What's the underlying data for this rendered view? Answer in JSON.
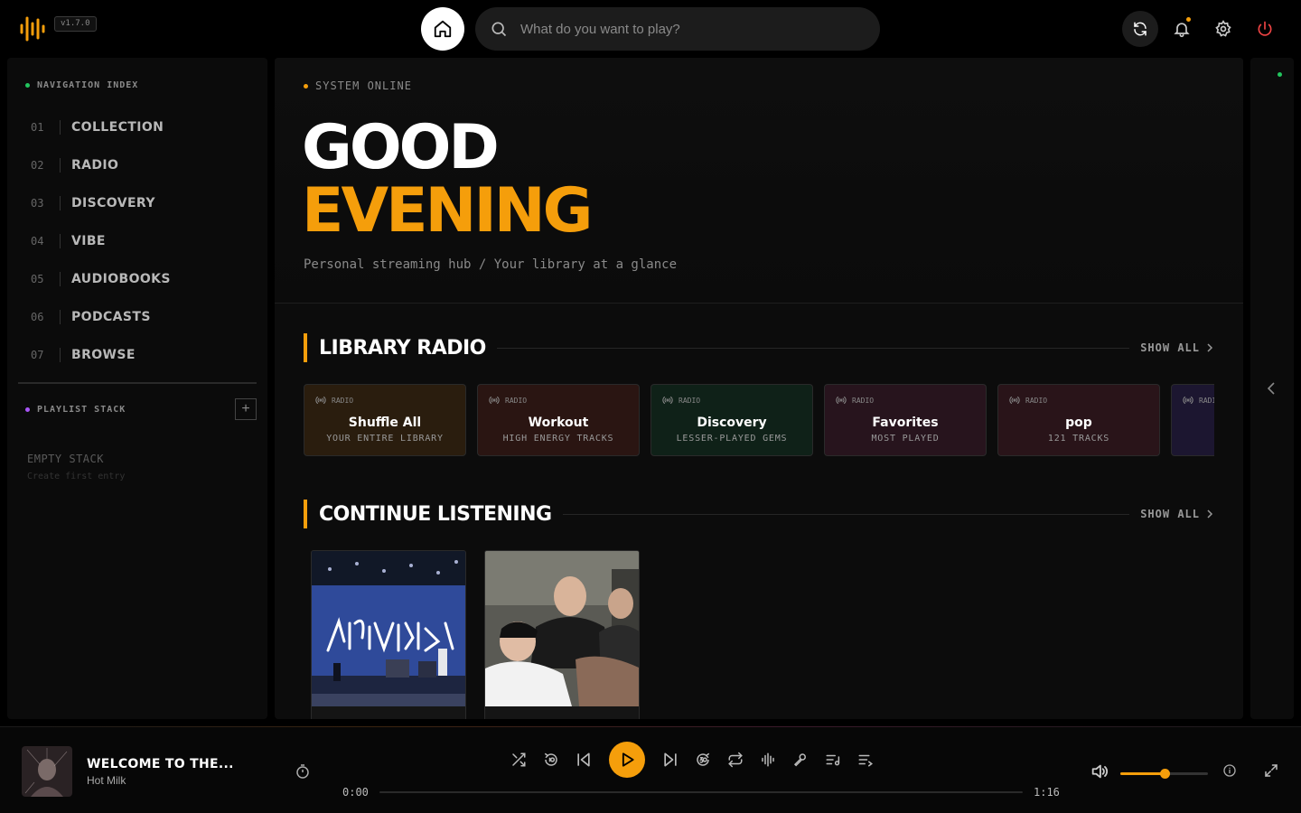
{
  "app": {
    "version": "v1.7.0"
  },
  "search": {
    "placeholder": "What do you want to play?"
  },
  "sidebar": {
    "nav_label": "NAVIGATION INDEX",
    "items": [
      {
        "num": "01",
        "label": "COLLECTION"
      },
      {
        "num": "02",
        "label": "RADIO"
      },
      {
        "num": "03",
        "label": "DISCOVERY"
      },
      {
        "num": "04",
        "label": "VIBE"
      },
      {
        "num": "05",
        "label": "AUDIOBOOKS"
      },
      {
        "num": "06",
        "label": "PODCASTS"
      },
      {
        "num": "07",
        "label": "BROWSE"
      }
    ],
    "playlist_label": "PLAYLIST STACK",
    "add_symbol": "+",
    "empty_title": "EMPTY STACK",
    "empty_sub": "Create first entry"
  },
  "hero": {
    "status": "SYSTEM ONLINE",
    "line1": "GOOD",
    "line2": "EVENING",
    "subtitle": "Personal streaming hub / Your library at a glance"
  },
  "library_radio": {
    "title": "LIBRARY RADIO",
    "show_all": "SHOW ALL",
    "cards": [
      {
        "tag": "RADIO",
        "title": "Shuffle All",
        "sub": "YOUR ENTIRE LIBRARY",
        "bg": "#2a1d0e"
      },
      {
        "tag": "RADIO",
        "title": "Workout",
        "sub": "HIGH ENERGY TRACKS",
        "bg": "#2a1512"
      },
      {
        "tag": "RADIO",
        "title": "Discovery",
        "sub": "LESSER-PLAYED GEMS",
        "bg": "#0f2118"
      },
      {
        "tag": "RADIO",
        "title": "Favorites",
        "sub": "MOST PLAYED",
        "bg": "#27141d"
      },
      {
        "tag": "RADIO",
        "title": "pop",
        "sub": "121 TRACKS",
        "bg": "#291419"
      },
      {
        "tag": "RADIO",
        "title": "",
        "sub": "",
        "bg": "#1c1630"
      }
    ]
  },
  "continue_listening": {
    "title": "CONTINUE LISTENING",
    "show_all": "SHOW ALL"
  },
  "player": {
    "title": "WELCOME TO THE...",
    "artist": "Hot Milk",
    "current": "0:00",
    "total": "1:16",
    "progress_fraction": 0.0,
    "volume_fraction": 0.5
  },
  "colors": {
    "accent": "#f59e0b",
    "online_green": "#22c55e",
    "playlist_purple": "#a855f7",
    "power_red": "#ef4444"
  },
  "icons": [
    "logo-icon",
    "home-icon",
    "search-icon",
    "refresh-icon",
    "bell-icon",
    "gear-icon",
    "power-icon",
    "radio-icon",
    "chevron-right-icon",
    "chevron-left-icon",
    "timer-icon",
    "shuffle-icon",
    "rewind-10-icon",
    "skip-previous-icon",
    "play-icon",
    "skip-next-icon",
    "forward-30-icon",
    "repeat-icon",
    "waveform-icon",
    "microphone-icon",
    "lyrics-icon",
    "queue-icon",
    "volume-icon",
    "info-icon",
    "fullscreen-icon"
  ]
}
